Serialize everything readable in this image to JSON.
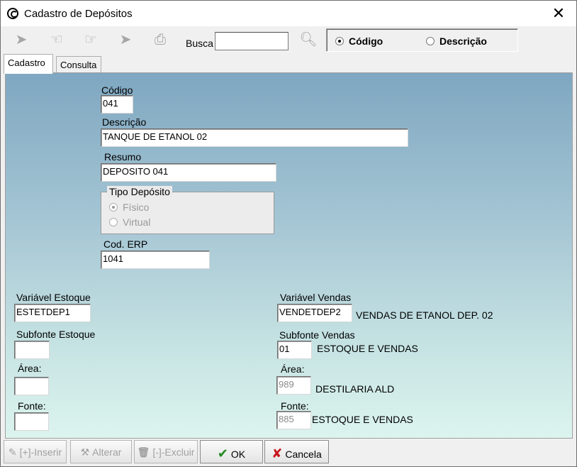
{
  "window": {
    "title": "Cadastro de Depósitos",
    "close_label": "✕"
  },
  "toolbar": {
    "icons": [
      "first-icon",
      "prev-icon",
      "next-icon",
      "last-icon",
      "print-icon",
      "zoom-icon"
    ],
    "busca_label": "Busca",
    "busca_value": "",
    "search_by": {
      "options": [
        "Código",
        "Descrição"
      ],
      "selected": "Código"
    }
  },
  "tabs": [
    {
      "label": "Cadastro",
      "active": true
    },
    {
      "label": "Consulta",
      "active": false
    }
  ],
  "form": {
    "codigo_label": "Código",
    "codigo_value": "041",
    "descricao_label": "Descrição",
    "descricao_value": "TANQUE DE ETANOL 02",
    "resumo_label": "Resumo",
    "resumo_value": "DEPOSITO 041",
    "tipo_deposito": {
      "legend": "Tipo Depósito",
      "options": [
        "Físico",
        "Virtual"
      ],
      "selected": "Físico"
    },
    "cod_erp_label": "Cod. ERP",
    "cod_erp_value": "1041",
    "variavel_estoque_label": "Variável Estoque",
    "variavel_estoque_value": "ESTETDEP1",
    "subfonte_estoque_label": "Subfonte Estoque",
    "subfonte_estoque_value": "",
    "area_estoque_label": "Área:",
    "area_estoque_value": "",
    "fonte_estoque_label": "Fonte:",
    "fonte_estoque_value": "",
    "variavel_vendas_label": "Variável Vendas",
    "variavel_vendas_value": "VENDETDEP2",
    "variavel_vendas_desc": "VENDAS DE ETANOL DEP. 02",
    "subfonte_vendas_label": "Subfonte Vendas",
    "subfonte_vendas_value": "01",
    "subfonte_vendas_desc": "ESTOQUE E VENDAS",
    "area_vendas_label": "Área:",
    "area_vendas_value": "989",
    "area_vendas_desc": "DESTILARIA ALD",
    "fonte_vendas_label": "Fonte:",
    "fonte_vendas_value": "885",
    "fonte_vendas_desc": "ESTOQUE E VENDAS"
  },
  "actions": {
    "inserir": "[+]-Inserir",
    "alterar": "Alterar",
    "excluir": "[-]-Excluir",
    "ok": "OK",
    "cancela": "Cancela"
  },
  "colors": {
    "ok_check": "#1f8a1f",
    "cancel_x": "#c8161d"
  }
}
